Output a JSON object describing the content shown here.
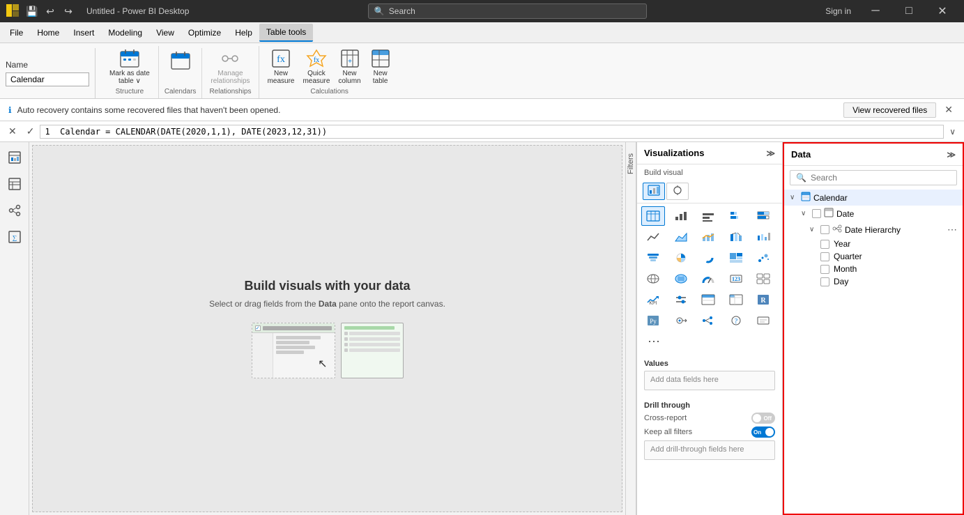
{
  "titleBar": {
    "appName": "Untitled - Power BI Desktop",
    "searchPlaceholder": "Search",
    "signinLabel": "Sign in",
    "undoTitle": "Undo",
    "redoTitle": "Redo"
  },
  "menuBar": {
    "items": [
      "File",
      "Home",
      "Insert",
      "Modeling",
      "View",
      "Optimize",
      "Help",
      "Table tools"
    ]
  },
  "ribbon": {
    "nameLabel": "Name",
    "nameValue": "Calendar",
    "groups": [
      {
        "label": "Structure",
        "items": [
          {
            "label": "Mark as date\ntable ∨",
            "icon": "📅",
            "disabled": false
          }
        ]
      },
      {
        "label": "Calendars",
        "items": [
          {
            "label": "",
            "icon": "📅",
            "disabled": false
          }
        ]
      },
      {
        "label": "Relationships",
        "items": [
          {
            "label": "Manage\nrelationships",
            "icon": "🔗",
            "disabled": false
          }
        ]
      },
      {
        "label": "Calculations",
        "items": [
          {
            "label": "New\nmeasure",
            "icon": "fx",
            "disabled": false
          },
          {
            "label": "Quick\nmeasure",
            "icon": "⚡",
            "disabled": false
          },
          {
            "label": "New\ncolumn",
            "icon": "📊",
            "disabled": false
          },
          {
            "label": "New\ntable",
            "icon": "📋",
            "disabled": false
          }
        ]
      }
    ]
  },
  "recoveryBar": {
    "message": "Auto recovery contains some recovered files that haven't been opened.",
    "buttonLabel": "View recovered files"
  },
  "formulaBar": {
    "formula": "1  Calendar = CALENDAR(DATE(2020,1,1), DATE(2023,12,31))"
  },
  "canvas": {
    "title": "Build visuals with your data",
    "subtitle": "Select or drag fields from the Data pane onto the report canvas."
  },
  "visualizations": {
    "panelTitle": "Visualizations",
    "buildVisualLabel": "Build visual",
    "valuesLabel": "Values",
    "valuesPlaceholder": "Add data fields here",
    "drillThroughLabel": "Drill through",
    "crossReportLabel": "Cross-report",
    "keepFiltersLabel": "Keep all filters",
    "drillDropPlaceholder": "Add drill-through fields here",
    "crossReportToggle": "Off",
    "keepFiltersToggle": "On"
  },
  "dataPanel": {
    "panelTitle": "Data",
    "searchPlaceholder": "Search",
    "tree": {
      "tableName": "Calendar",
      "dateField": "Date",
      "hierarchyName": "Date Hierarchy",
      "hierarchyItems": [
        "Year",
        "Quarter",
        "Month",
        "Day"
      ]
    }
  },
  "filters": {
    "label": "Filters"
  },
  "icons": {
    "search": "🔍",
    "settings": "⚙",
    "expand": "≫",
    "info": "ℹ",
    "close": "✕",
    "check": "✓",
    "expand_down": "∨",
    "more": "⋯"
  }
}
